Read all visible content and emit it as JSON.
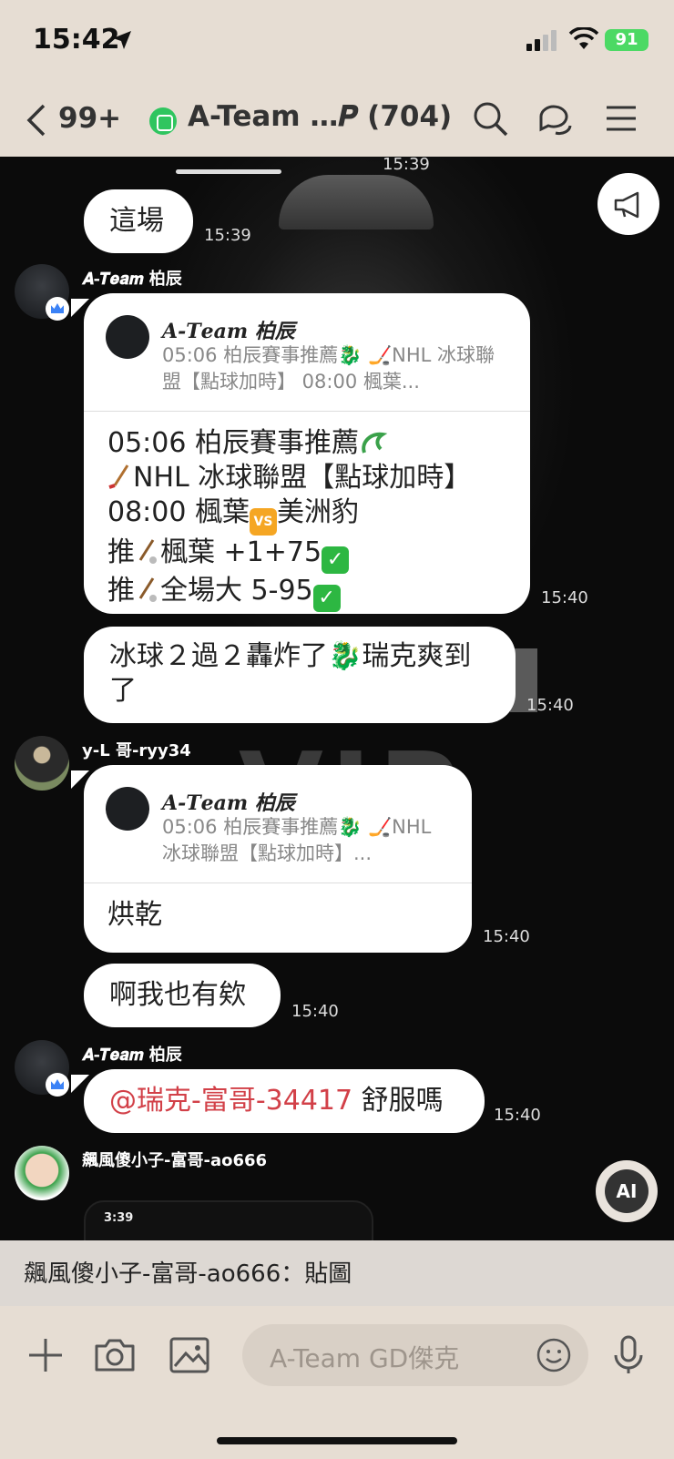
{
  "status_bar": {
    "time": "15:42",
    "battery": "91"
  },
  "header": {
    "back_count": "99+",
    "title": "A-Team …𝑷 (704)",
    "icons": [
      "back-icon",
      "group-icon",
      "search-icon",
      "chat-icon",
      "menu-icon"
    ]
  },
  "chat": {
    "top_timestamp": "15:39",
    "watermark": "VIP",
    "messages": [
      {
        "text": "這場",
        "time": "15:39"
      },
      {
        "sender": "𝑨-𝑻𝒆𝒂𝒎 柏辰",
        "reply_name": "𝑨-𝑻𝒆𝒂𝒎 柏辰",
        "reply_preview": "05:06 柏辰賽事推薦🐉 🏒NHL 冰球聯盟【點球加時】 08:00 楓葉...",
        "body_lines": [
          "05:06 柏辰賽事推薦",
          "NHL 冰球聯盟【點球加時】",
          "08:00 楓葉",
          "美洲豹",
          "推",
          "楓葉 +1+75",
          "推",
          "全場大 5-95"
        ],
        "time": "15:40"
      },
      {
        "text": "冰球２過２轟炸了🐉瑞克爽到了",
        "time": "15:40"
      },
      {
        "sender": "y-L 哥-ryy34",
        "reply_name": "𝑨-𝑻𝒆𝒂𝒎 柏辰",
        "reply_preview": "05:06 柏辰賽事推薦🐉 🏒NHL 冰球聯盟【點球加時】...",
        "body": "烘乾",
        "time": "15:40"
      },
      {
        "text": "啊我也有欸",
        "time": "15:40"
      },
      {
        "sender": "𝑨-𝑻𝒆𝒂𝒎 柏辰",
        "mention": "@瑞克-富哥-34417",
        "text": " 舒服嗎",
        "time": "15:40"
      },
      {
        "sender": "飆風傻小子-富哥-ao666",
        "thumb_time": "3:39"
      }
    ],
    "ai_label": "AI"
  },
  "notice": {
    "text": "飆風傻小子-富哥-ao666：貼圖"
  },
  "input": {
    "placeholder": "A-Team GD傑克"
  },
  "colors": {
    "header_bg": "#e6ddd3",
    "mention": "#d24048",
    "check": "#2db742",
    "vs": "#f5a623"
  }
}
